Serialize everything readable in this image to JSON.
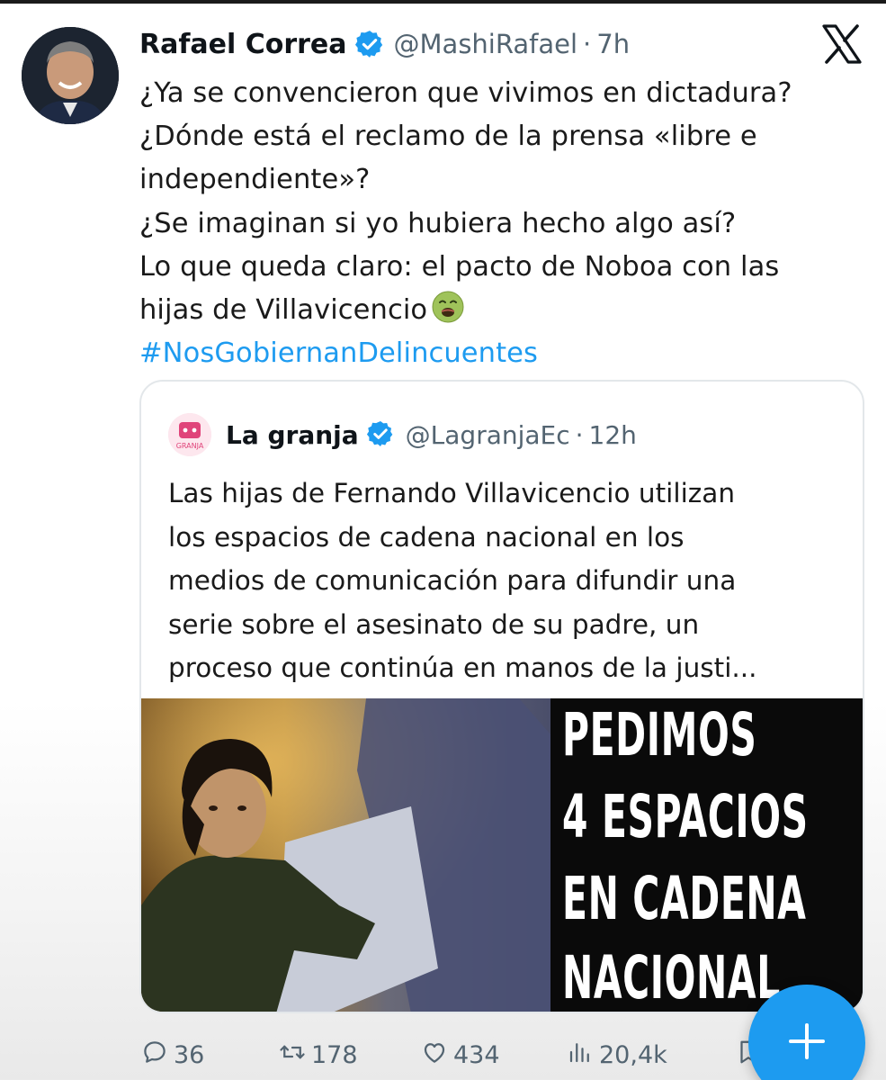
{
  "tweet": {
    "author_name": "Rafael Correa",
    "author_handle": "@MashiRafael",
    "separator": "·",
    "time": "7h",
    "lines": [
      "¿Ya se convencieron que vivimos en dictadura?",
      "¿Dónde está el reclamo de la prensa «libre e",
      "independiente»?",
      "¿Se imaginan si yo hubiera hecho algo así?",
      "Lo que queda claro: el pacto de Noboa con las",
      "hijas de Villavicencio"
    ],
    "emoji_icon": "nauseated-face-emoji",
    "hashtag": "#NosGobiernanDelincuentes"
  },
  "quoted_tweet": {
    "author_name": "La granja",
    "author_handle": "@LagranjaEc",
    "separator": "·",
    "time": "12h",
    "avatar_text": "GRANJA",
    "lines": [
      "Las hijas de Fernando Villavicencio utilizan",
      "los espacios de cadena nacional en los",
      "medios de comunicación para difundir una",
      "serie sobre el asesinato de su padre, un",
      "proceso que continúa en manos de la justi..."
    ],
    "media_overlay": [
      "PEDIMOS",
      "4 ESPACIOS",
      "EN CADENA",
      "NACIONAL"
    ]
  },
  "actions": {
    "replies": "36",
    "retweets": "178",
    "likes": "434",
    "views": "20,4k"
  },
  "colors": {
    "accent": "#1d9bf0",
    "text": "#0f1419",
    "secondary": "#536471"
  }
}
